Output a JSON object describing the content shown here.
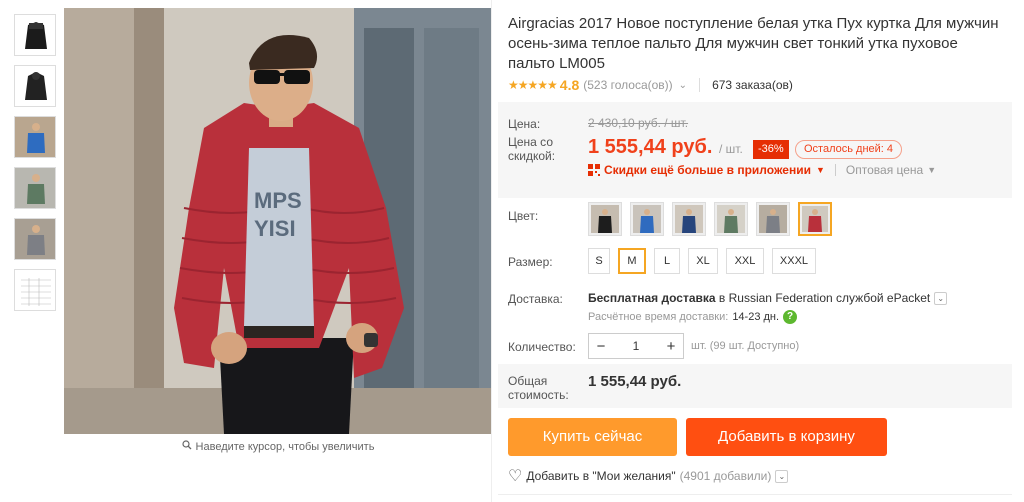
{
  "product": {
    "title": "Airgracias 2017 Новое поступление белая утка Пух куртка Для мужчин осень-зима теплое пальто Для мужчин свет тонкий утка пуховое пальто LM005",
    "stars": "★★★★★",
    "rating": "4.8",
    "votes": "(523 голоса(ов))",
    "orders": "673 заказа(ов)"
  },
  "gallery": {
    "zoom_hint": "Наведите курсор, чтобы увеличить",
    "thumbnail_count": 6
  },
  "price": {
    "label": "Цена:",
    "old": "2 430,10 руб. / шт.",
    "discount_label": "Цена со скидкой:",
    "new": "1 555,44 руб.",
    "per_unit": "/ шт.",
    "discount": "-36%",
    "days_left": "Осталось дней: 4",
    "app_promo": "Скидки ещё больше в приложении",
    "wholesale": "Оптовая цена"
  },
  "options": {
    "color_label": "Цвет:",
    "size_label": "Размер:",
    "sizes": [
      "S",
      "M",
      "L",
      "XL",
      "XXL",
      "XXXL"
    ],
    "selected_size": "M",
    "selected_color_index": 5
  },
  "shipping": {
    "label": "Доставка:",
    "free": "Бесплатная доставка",
    "in": "в Russian Federation службой ePacket",
    "time_label": "Расчётное время доставки:",
    "time": "14-23 дн."
  },
  "quantity": {
    "label": "Количество:",
    "value": "1",
    "available": "шт. (99 шт. Доступно)"
  },
  "total": {
    "label": "Общая стоимость:",
    "value": "1 555,44 руб."
  },
  "actions": {
    "buy_now": "Купить сейчас",
    "add_to_cart": "Добавить в корзину",
    "wishlist": "Добавить в \"Мои желания\"",
    "wishlist_count": "(4901 добавили)"
  },
  "colors": {
    "accent": "#f0411b",
    "buy": "#ff9a2c",
    "cart": "#ff4f11",
    "star": "#f5a623"
  }
}
